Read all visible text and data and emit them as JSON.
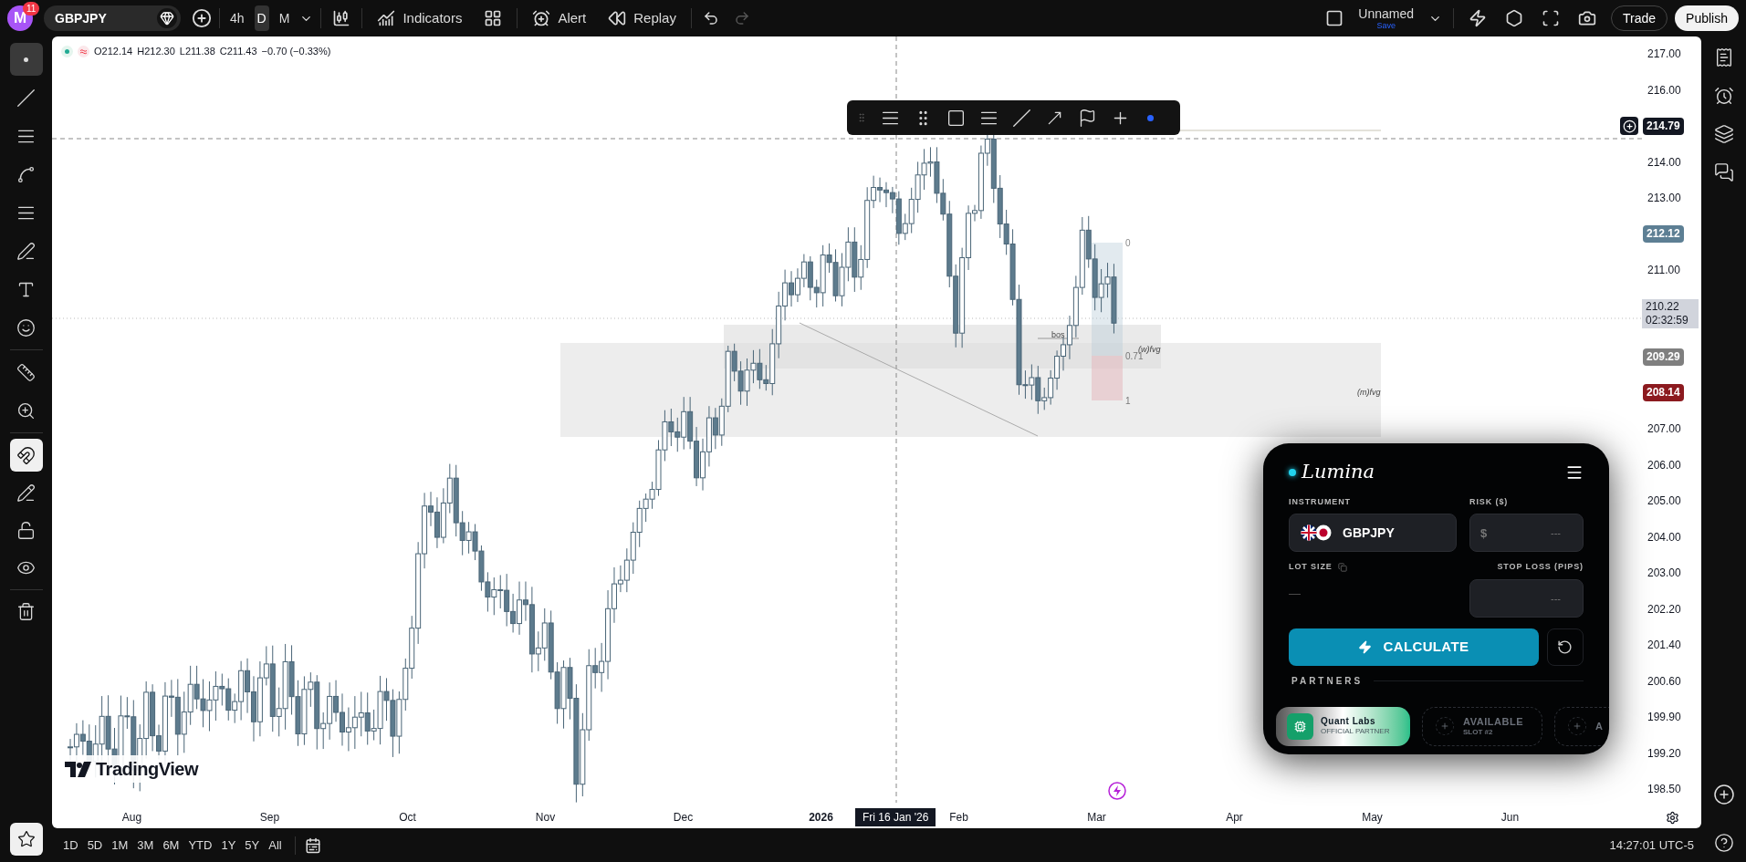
{
  "top_bar": {
    "avatar": {
      "letter": "M",
      "badge": "11"
    },
    "symbol": "GBPJPY",
    "intervals": [
      {
        "label": "4h",
        "selected": false
      },
      {
        "label": "D",
        "selected": true
      },
      {
        "label": "M",
        "selected": false
      }
    ],
    "buttons": [
      "Indicators",
      "Alert",
      "Replay"
    ],
    "redo_disabled": true,
    "layout": {
      "name": "Unnamed",
      "save": "Save"
    },
    "actions": [
      "Trade",
      "Publish"
    ]
  },
  "left_toolbar": {
    "tools": [
      {
        "selected": true
      },
      {
        "selected": false
      },
      {
        "selected": false
      },
      {
        "selected": false
      },
      {
        "selected": false
      },
      {
        "selected": false
      },
      {
        "selected": false
      },
      {
        "selected": false
      },
      {
        "selected": false
      },
      {
        "selected": false
      }
    ],
    "magnet": {
      "on": true
    }
  },
  "legend": {
    "parts": [
      {
        "label": "O",
        "value": "212.14"
      },
      {
        "label": "H",
        "value": "212.30"
      },
      {
        "label": "L",
        "value": "211.38"
      },
      {
        "label": "C",
        "value": "211.43"
      }
    ],
    "change": "−0.70 (−0.33%)"
  },
  "price_scale": [
    {
      "kind": "tick",
      "label": "217.00"
    },
    {
      "kind": "tick",
      "label": "216.00"
    },
    {
      "kind": "crosshair",
      "label": "214.79",
      "color": "#131722"
    },
    {
      "kind": "tick",
      "label": "214.00"
    },
    {
      "kind": "tick",
      "label": "213.00"
    },
    {
      "kind": "badge",
      "label": "212.12",
      "color": "#5d7f94"
    },
    {
      "kind": "tick",
      "label": "211.00"
    },
    {
      "kind": "countdown",
      "label": "210.22",
      "sub": "02:32:59",
      "color": "#d1d4dc"
    },
    {
      "kind": "badge",
      "label": "209.29",
      "color": "#7f7f7f"
    },
    {
      "kind": "badge",
      "label": "208.14",
      "color": "#8c1a1f"
    },
    {
      "kind": "tick",
      "label": "207.00"
    },
    {
      "kind": "tick",
      "label": "206.00"
    },
    {
      "kind": "tick",
      "label": "205.00"
    },
    {
      "kind": "tick",
      "label": "204.00"
    },
    {
      "kind": "tick",
      "label": "203.00"
    },
    {
      "kind": "tick",
      "label": "202.20"
    },
    {
      "kind": "tick",
      "label": "201.40"
    },
    {
      "kind": "tick",
      "label": "200.60"
    },
    {
      "kind": "tick",
      "label": "199.90"
    },
    {
      "kind": "tick",
      "label": "199.20"
    },
    {
      "kind": "tick",
      "label": "198.50"
    }
  ],
  "annotations": [
    "bos",
    "(w)fvg",
    "(m)fvg",
    "0",
    "0.71",
    "1"
  ],
  "logo": "TradingView",
  "time_scale": {
    "labels": [
      {
        "label": "Aug",
        "bold": false
      },
      {
        "label": "Sep",
        "bold": false
      },
      {
        "label": "Oct",
        "bold": false
      },
      {
        "label": "Nov",
        "bold": false
      },
      {
        "label": "Dec",
        "bold": false
      },
      {
        "label": "2026",
        "bold": true
      },
      {
        "label": "Feb",
        "bold": false
      },
      {
        "label": "Mar",
        "bold": false
      },
      {
        "label": "Apr",
        "bold": false
      },
      {
        "label": "May",
        "bold": false
      },
      {
        "label": "Jun",
        "bold": false
      }
    ],
    "crosshair": "Fri 16 Jan '26"
  },
  "bottom_bar": {
    "ranges": [
      "1D",
      "5D",
      "1M",
      "3M",
      "6M",
      "YTD",
      "1Y",
      "5Y",
      "All"
    ],
    "time": "14:27:01 UTC-5"
  },
  "lumina": {
    "title": "Lumina",
    "instrument": {
      "label": "INSTRUMENT",
      "value": "GBPJPY"
    },
    "risk": {
      "label": "RISK ($)",
      "prefix": "$",
      "placeholder": "---"
    },
    "lot_size": {
      "label": "LOT SIZE",
      "value": "—"
    },
    "stop_loss": {
      "label": "STOP LOSS (PIPS)",
      "placeholder": "---"
    },
    "calculate": "CALCULATE",
    "partners_title": "PARTNERS",
    "partners": [
      {
        "kind": "partner",
        "name": "Quant Labs",
        "tag": "OFFICIAL PARTNER"
      },
      {
        "kind": "slot",
        "name": "AVAILABLE",
        "tag": "SLOT #2"
      },
      {
        "kind": "slot",
        "name": "A"
      }
    ]
  }
}
